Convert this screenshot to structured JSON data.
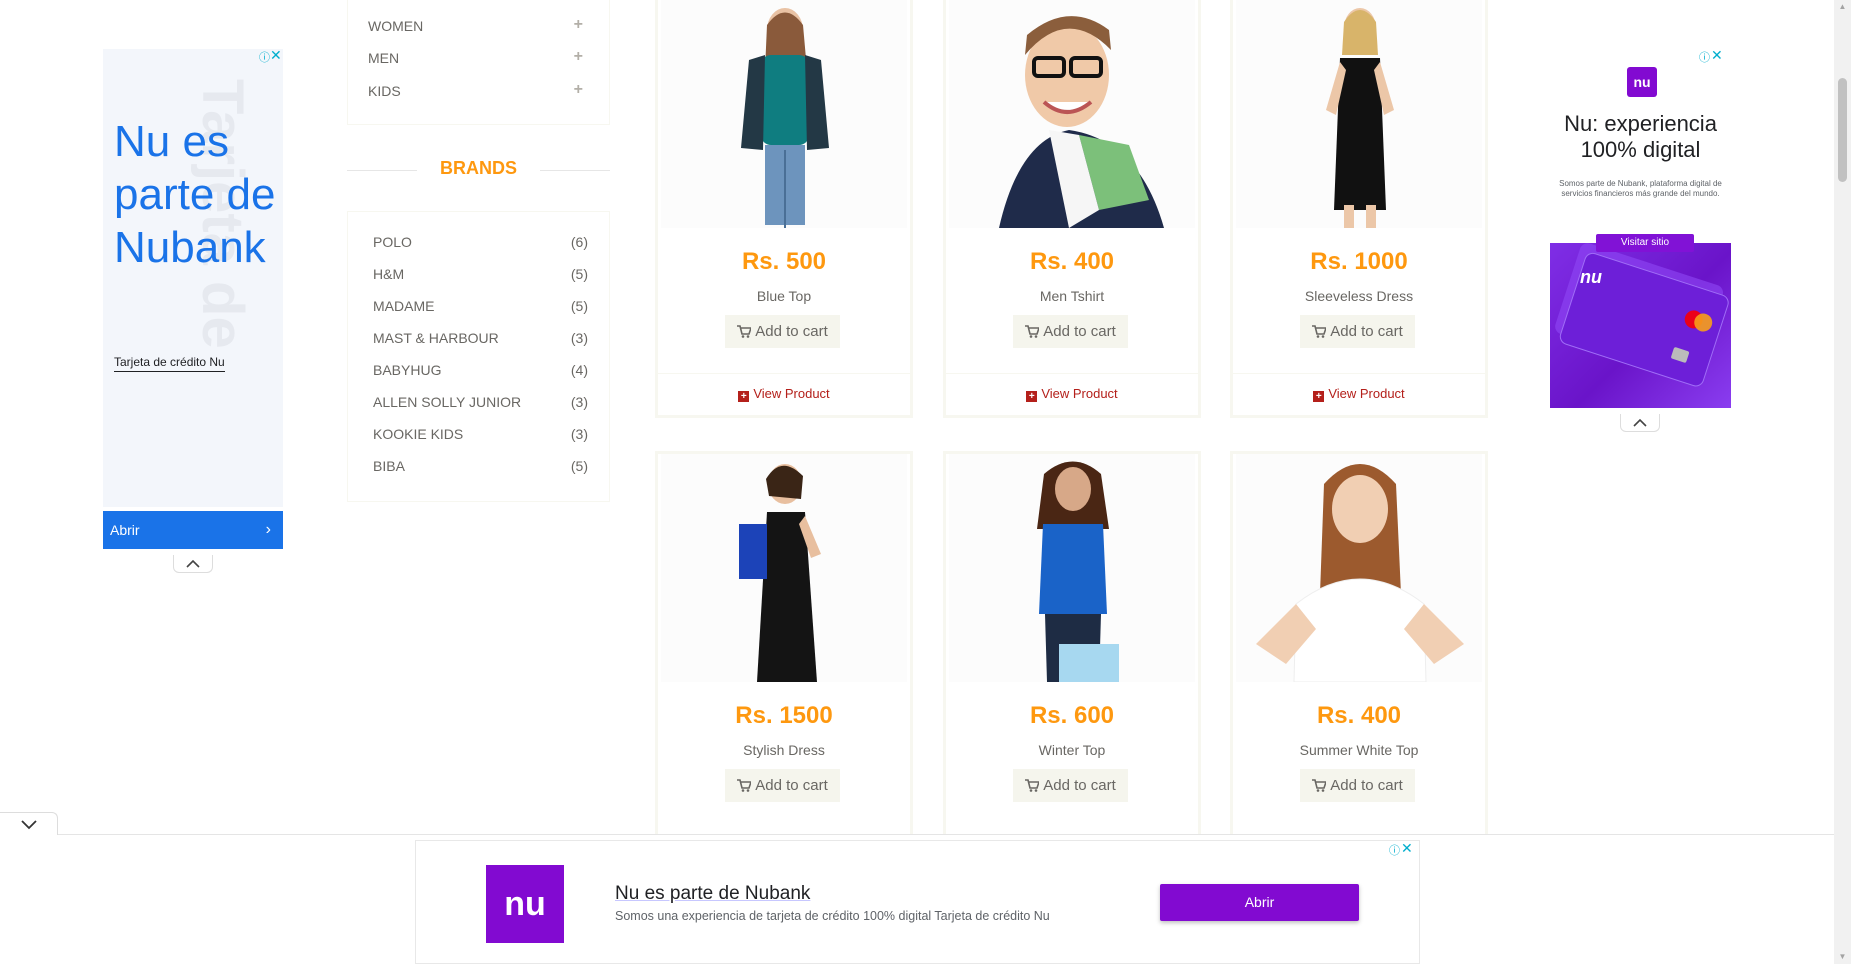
{
  "categories": [
    {
      "label": "WOMEN"
    },
    {
      "label": "MEN"
    },
    {
      "label": "KIDS"
    }
  ],
  "brands_title": "BRANDS",
  "brands": [
    {
      "name": "POLO",
      "count": "(6)"
    },
    {
      "name": "H&M",
      "count": "(5)"
    },
    {
      "name": "MADAME",
      "count": "(5)"
    },
    {
      "name": "MAST & HARBOUR",
      "count": "(3)"
    },
    {
      "name": "BABYHUG",
      "count": "(4)"
    },
    {
      "name": "ALLEN SOLLY JUNIOR",
      "count": "(3)"
    },
    {
      "name": "KOOKIE KIDS",
      "count": "(3)"
    },
    {
      "name": "BIBA",
      "count": "(5)"
    }
  ],
  "products": [
    {
      "price": "Rs. 500",
      "name": "Blue Top",
      "cart": "Add to cart",
      "view": "View Product"
    },
    {
      "price": "Rs. 400",
      "name": "Men Tshirt",
      "cart": "Add to cart",
      "view": "View Product"
    },
    {
      "price": "Rs. 1000",
      "name": "Sleeveless Dress",
      "cart": "Add to cart",
      "view": "View Product"
    },
    {
      "price": "Rs. 1500",
      "name": "Stylish Dress",
      "cart": "Add to cart",
      "view": ""
    },
    {
      "price": "Rs. 600",
      "name": "Winter Top",
      "cart": "Add to cart",
      "view": ""
    },
    {
      "price": "Rs. 400",
      "name": "Summer White Top",
      "cart": "Add to cart",
      "view": ""
    }
  ],
  "left_ad": {
    "headline": "Nu es parte de Nubank",
    "subtitle": "Tarjeta de crédito Nu",
    "button": "Abrir",
    "watermark": "Tarjeta de"
  },
  "right_ad": {
    "logo": "nu",
    "headline": "Nu: experiencia 100% digital",
    "small_text": "Somos parte de Nubank, plataforma digital de servicios financieros más grande del mundo.",
    "visit_button": "Visitar sitio",
    "card_brand": "nu"
  },
  "bottom_ad": {
    "logo": "nu",
    "title": "Nu es parte de Nubank",
    "description": "Somos una experiencia de tarjeta de crédito 100% digital Tarjeta de crédito Nu",
    "button": "Abrir"
  },
  "colors": {
    "accent": "#FE980F",
    "nubank_purple": "#820AD1",
    "ad_blue": "#1A73E8",
    "view_red": "#B4201B"
  }
}
